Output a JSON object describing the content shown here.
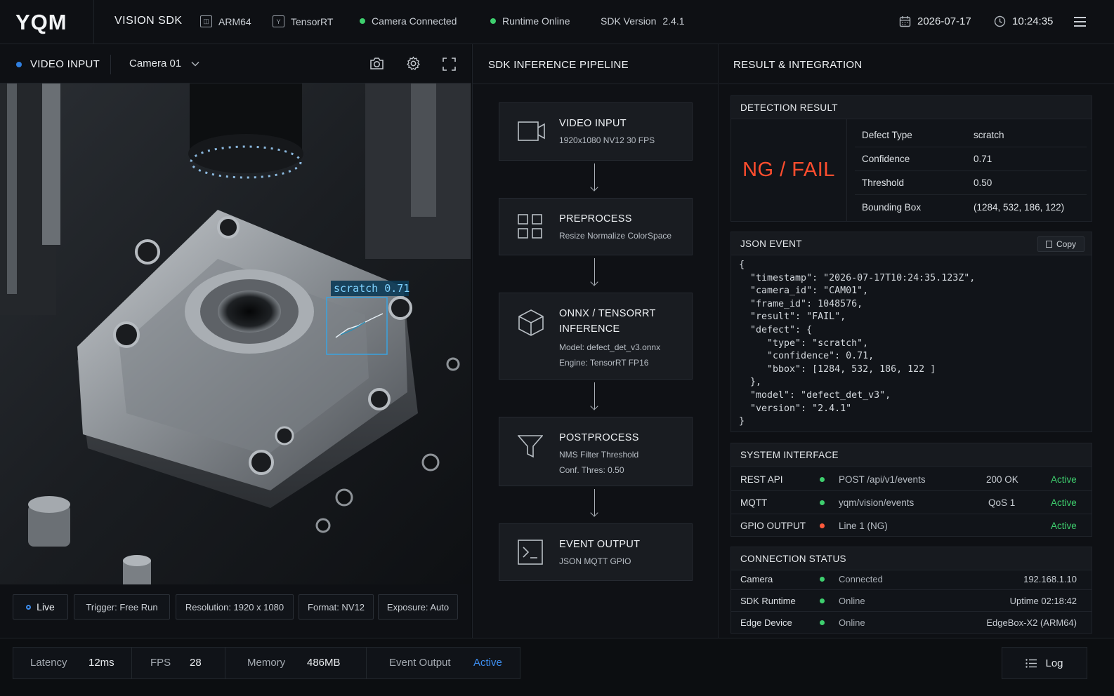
{
  "topbar": {
    "logo": "YQM",
    "product": "VISION SDK",
    "arch": "ARM64",
    "engine": "TensorRT",
    "camera_status": "Camera Connected",
    "runtime_status": "Runtime Online",
    "sdk_version_label": "SDK Version",
    "sdk_version": "2.4.1",
    "date": "2026-07-17",
    "time": "10:24:35"
  },
  "video": {
    "title": "VIDEO INPUT",
    "camera": "Camera 01",
    "detection_label": "scratch 0.71",
    "chips": {
      "live": "Live",
      "trigger": "Trigger:  Free Run",
      "resolution": "Resolution:  1920 x 1080",
      "format": "Format:  NV12",
      "exposure": "Exposure:  Auto"
    }
  },
  "pipeline": {
    "title": "SDK INFERENCE PIPELINE",
    "stages": [
      {
        "title": "VIDEO INPUT",
        "sub1": "1920x1080   NV12   30 FPS"
      },
      {
        "title": "PREPROCESS",
        "sub1": "Resize   Normalize   ColorSpace"
      },
      {
        "title": "ONNX / TENSORRT INFERENCE",
        "sub1": "Model:  defect_det_v3.onnx",
        "sub2": "Engine:  TensorRT FP16"
      },
      {
        "title": "POSTPROCESS",
        "sub1": "NMS     Filter     Threshold",
        "sub2": "Conf. Thres:  0.50"
      },
      {
        "title": "EVENT OUTPUT",
        "sub1": "JSON     MQTT     GPIO"
      }
    ]
  },
  "result": {
    "title": "RESULT & INTEGRATION",
    "detection": {
      "header": "DETECTION RESULT",
      "verdict": "NG / FAIL",
      "rows": [
        {
          "k": "Defect Type",
          "v": "scratch"
        },
        {
          "k": "Confidence",
          "v": "0.71"
        },
        {
          "k": "Threshold",
          "v": "0.50"
        },
        {
          "k": "Bounding Box",
          "v": "(1284, 532, 186, 122)"
        }
      ]
    },
    "json_event": {
      "header": "JSON EVENT",
      "copy": "Copy",
      "body": "{\n  \"timestamp\": \"2026-07-17T10:24:35.123Z\",\n  \"camera_id\": \"CAM01\",\n  \"frame_id\": 1048576,\n  \"result\": \"FAIL\",\n  \"defect\": {\n     \"type\": \"scratch\",\n     \"confidence\": 0.71,\n     \"bbox\": [1284, 532, 186, 122 ]\n  },\n  \"model\": \"defect_det_v3\",\n  \"version\": \"2.4.1\"\n}"
    },
    "system_interface": {
      "header": "SYSTEM INTERFACE",
      "rows": [
        {
          "name": "REST API",
          "endpoint": "POST /api/v1/events",
          "code": "200 OK",
          "status": "Active",
          "dot": "#3ecf6e"
        },
        {
          "name": "MQTT",
          "endpoint": "yqm/vision/events",
          "code": "QoS 1",
          "status": "Active",
          "dot": "#3ecf6e"
        },
        {
          "name": "GPIO OUTPUT",
          "endpoint": "Line 1 (NG)",
          "code": "",
          "status": "Active",
          "dot": "#ff5a3c"
        }
      ]
    },
    "connection_status": {
      "header": "CONNECTION STATUS",
      "rows": [
        {
          "name": "Camera",
          "state": "Connected",
          "detail": "192.168.1.10"
        },
        {
          "name": "SDK Runtime",
          "state": "Online",
          "detail": "Uptime 02:18:42"
        },
        {
          "name": "Edge Device",
          "state": "Online",
          "detail": "EdgeBox-X2 (ARM64)"
        }
      ]
    }
  },
  "bottombar": {
    "latency_label": "Latency",
    "latency": "12ms",
    "fps_label": "FPS",
    "fps": "28",
    "memory_label": "Memory",
    "memory": "486MB",
    "event_label": "Event Output",
    "event": "Active",
    "log": "Log"
  },
  "colors": {
    "accent_blue": "#3d8ef0",
    "fail_red": "#ff4d2e",
    "active_green": "#3ecf6e",
    "box_cyan": "#3aa3e0"
  }
}
